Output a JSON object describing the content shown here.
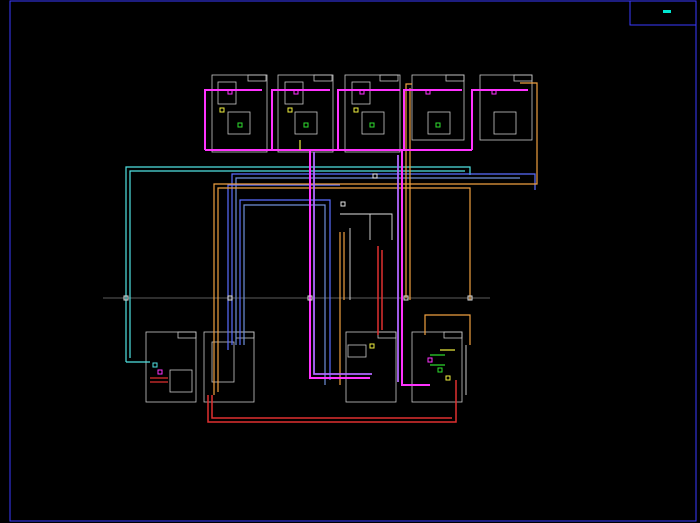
{
  "drawing": {
    "background": "#000000",
    "frame_color": "#3a3aff",
    "title_block_mark_color": "#00e5d0"
  },
  "colors": {
    "magenta": "#ff33ff",
    "violet": "#b266ff",
    "cyan": "#4fe3e3",
    "blue": "#5a6dff",
    "steelblue": "#6f8fd8",
    "orange": "#f0a040",
    "red": "#e03030",
    "white": "#e0e0e0",
    "yellow": "#f0f040",
    "green": "#30e030",
    "gray": "#b8b8b8"
  }
}
